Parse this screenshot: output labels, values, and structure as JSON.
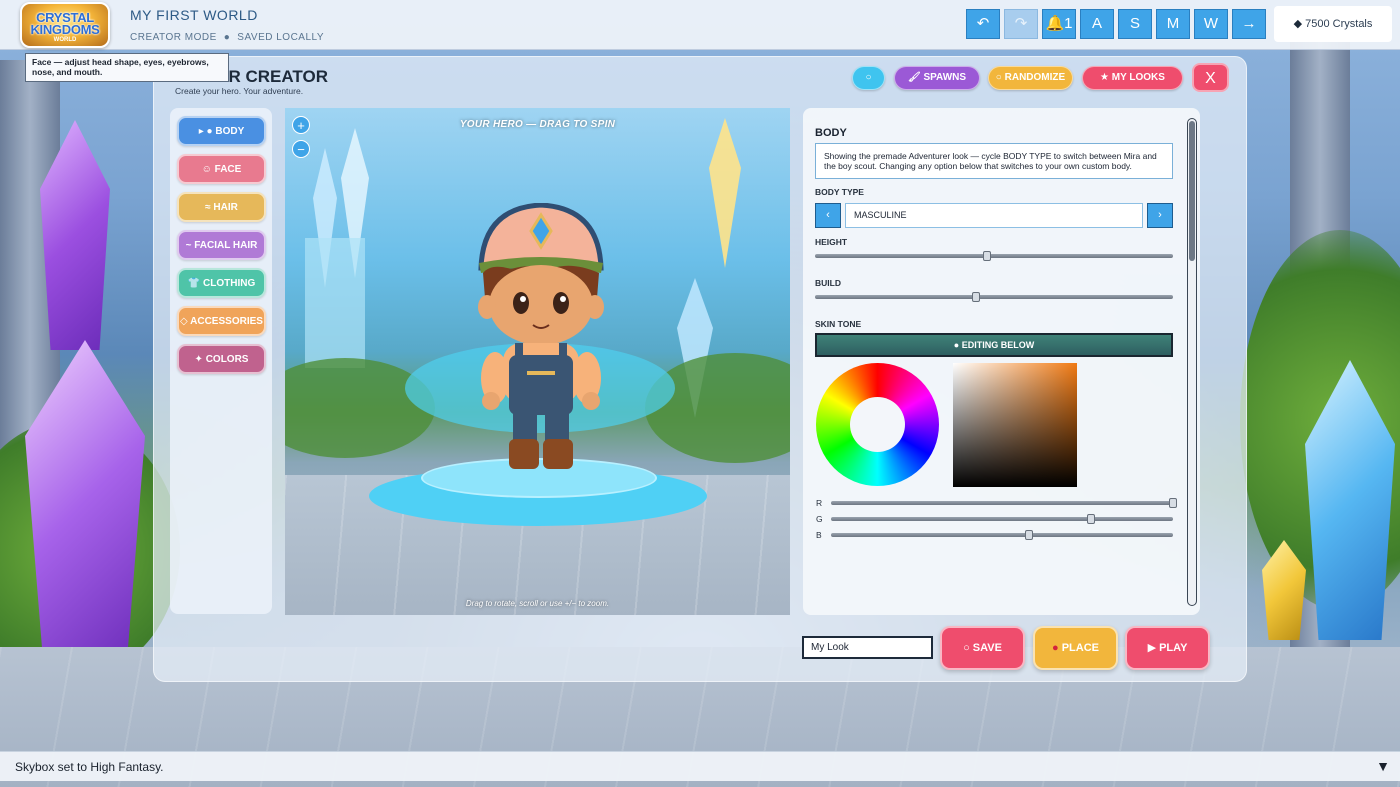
{
  "app": {
    "logo_text_line1": "CRYSTAL",
    "logo_text_line2": "KINGDOMS",
    "logo_text_line3": "WORLD",
    "world_title": "MY FIRST WORLD",
    "mode": "CREATOR MODE",
    "save_state": "SAVED LOCALLY"
  },
  "toolbar": {
    "buttons": [
      {
        "label": "↶",
        "icon": "undo-icon"
      },
      {
        "label": "↷",
        "icon": "redo-icon"
      },
      {
        "label": "1",
        "icon": "bell-icon"
      },
      {
        "label": "A"
      },
      {
        "label": "S"
      },
      {
        "label": "M"
      },
      {
        "label": "W"
      },
      {
        "label": "→",
        "icon": "arrow-right-icon"
      }
    ],
    "crystals": "7500 Crystals"
  },
  "tooltip": "Face — adjust head shape, eyes, eyebrows, nose, and mouth.",
  "panel": {
    "title": "AVATAR CREATOR",
    "subtitle": "Create your hero. Your adventure.",
    "header_buttons": {
      "info": "○",
      "spawns": "SPAWNS",
      "randomize": "RANDOMIZE",
      "my_looks": "MY LOOKS",
      "close": "X"
    }
  },
  "categories": [
    {
      "label": "▸ ● BODY",
      "name": "body",
      "color": "#4a90e2"
    },
    {
      "label": "☺ FACE",
      "name": "face",
      "color": "#e87a8f"
    },
    {
      "label": "≈ HAIR",
      "name": "hair",
      "color": "#e6b85a"
    },
    {
      "label": "~ FACIAL HAIR",
      "name": "facial-hair",
      "color": "#b07ad6"
    },
    {
      "label": "CLOTHING",
      "name": "clothing",
      "color": "#4fc4a8"
    },
    {
      "label": "◇ ACCESSORIES",
      "name": "accessories",
      "color": "#f0a45a"
    },
    {
      "label": "✦ COLORS",
      "name": "colors",
      "color": "#c0628e"
    }
  ],
  "viewport": {
    "title": "YOUR HERO — DRAG TO SPIN",
    "hint": "Drag to rotate, scroll or use +/− to zoom.",
    "zoom_in": "+",
    "zoom_out": "−"
  },
  "options": {
    "section": "BODY",
    "info": "Showing the premade Adventurer look — cycle BODY TYPE to switch between Mira and the boy scout. Changing any option below that switches to your own custom body.",
    "body_type_label": "BODY TYPE",
    "body_type_value": "MASCULINE",
    "prev": "‹",
    "next": "›",
    "height_label": "HEIGHT",
    "height_value": 0.48,
    "build_label": "BUILD",
    "build_value": 0.45,
    "skin_tone_label": "SKIN TONE",
    "editing_label": "● EDITING BELOW",
    "r_label": "R",
    "g_label": "G",
    "b_label": "B",
    "r_value": 1.0,
    "g_value": 0.76,
    "b_value": 0.58
  },
  "footer": {
    "name_value": "My Look",
    "save": "SAVE",
    "place": "PLACE",
    "play": "PLAY"
  },
  "status": {
    "message": "Skybox set to High Fantasy.",
    "caret": "▼"
  },
  "colors": {
    "accent_blue": "#3fa4e8",
    "spawns": "#9b59d6",
    "randomize": "#f2b63c",
    "my_looks": "#ef4d6d",
    "save": "#ef4d6d",
    "place": "#f2b63c",
    "play": "#ef4d6d"
  }
}
